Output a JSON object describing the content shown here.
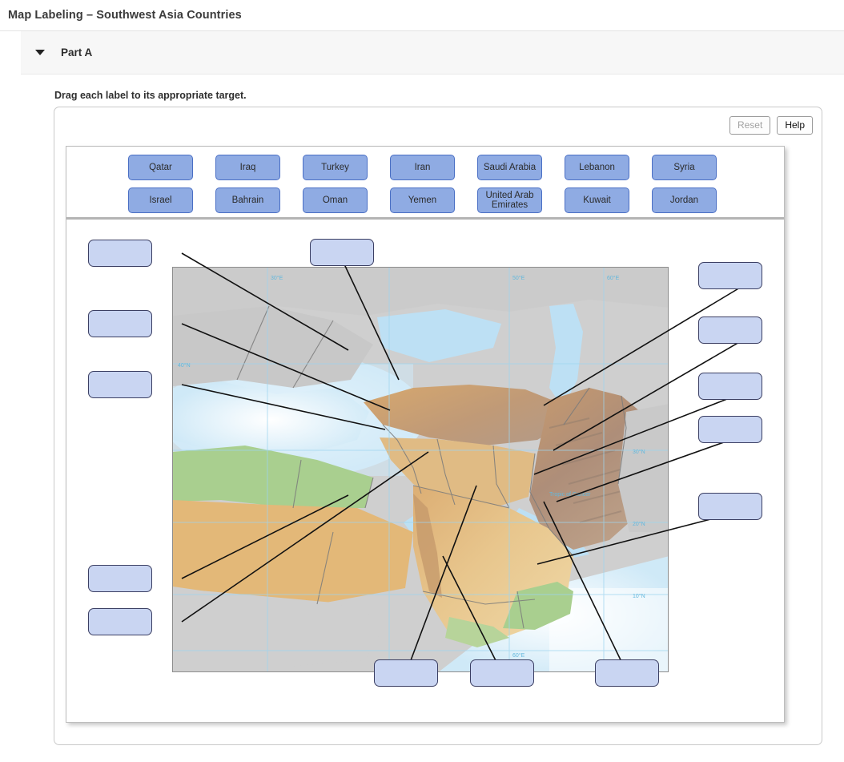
{
  "page": {
    "title": "Map Labeling – Southwest Asia Countries"
  },
  "part": {
    "label": "Part A",
    "caret_icon": "caret-down-icon",
    "instruction": "Drag each label to its appropriate target."
  },
  "toolbar": {
    "reset_label": "Reset",
    "reset_disabled": true,
    "help_label": "Help",
    "help_disabled": false
  },
  "label_bank": {
    "row1": [
      "Qatar",
      "Iraq",
      "Turkey",
      "Iran",
      "Saudi Arabia",
      "Lebanon",
      "Syria"
    ],
    "row2": [
      "Israel",
      "Bahrain",
      "Oman",
      "Yemen",
      "United Arab Emirates",
      "Kuwait",
      "Jordan"
    ]
  },
  "targets": {
    "count": 14,
    "values": [
      "",
      "",
      "",
      "",
      "",
      "",
      "",
      "",
      "",
      "",
      "",
      "",
      "",
      ""
    ]
  },
  "map": {
    "alt": "Physical relief map of Southwest Asia and the Middle East",
    "gridline_labels": [
      "30°E",
      "50°E",
      "60°E",
      "40°N",
      "30°N",
      "20°N",
      "10°N",
      "Tropic of Cancer"
    ],
    "colors": {
      "ocean": "#cfe9f7",
      "lowland_green": "#a9cf8f",
      "desert_tan": "#e3b878",
      "highland_brown": "#b08a63",
      "outside_grey": "#cfcfcf",
      "border_line": "#7b7b7b"
    }
  }
}
